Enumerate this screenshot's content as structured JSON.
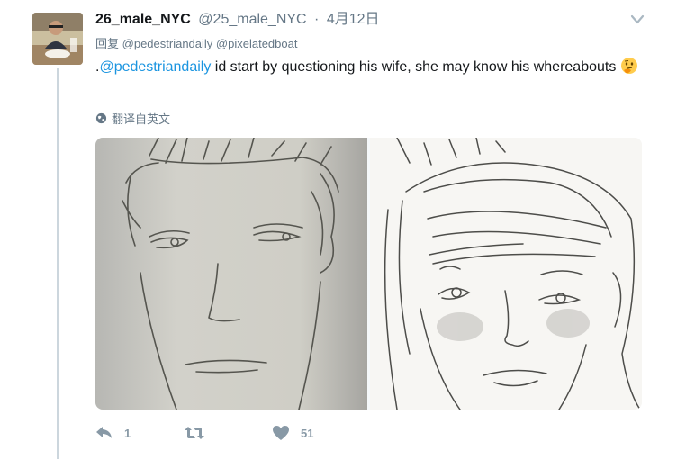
{
  "tweet": {
    "display_name": "26_male_NYC",
    "handle": "@25_male_NYC",
    "separator": "·",
    "timestamp": "4月12日",
    "reply_prefix": "回复",
    "reply_to": [
      "@pedestriandaily",
      "@pixelatedboat"
    ],
    "text_prefix": ".",
    "text_mention": "@pedestriandaily",
    "text_body": " id start by questioning his wife, she may know his whereabouts",
    "emoji_icon": "thinking-face-icon",
    "translate_label": "翻译自英文",
    "actions": {
      "reply_count": "1",
      "retweet_count": "",
      "like_count": "51"
    }
  },
  "colors": {
    "link": "#1b95e0",
    "muted": "#657786",
    "action": "#8899a6",
    "thread_line": "#ccd6dd"
  }
}
